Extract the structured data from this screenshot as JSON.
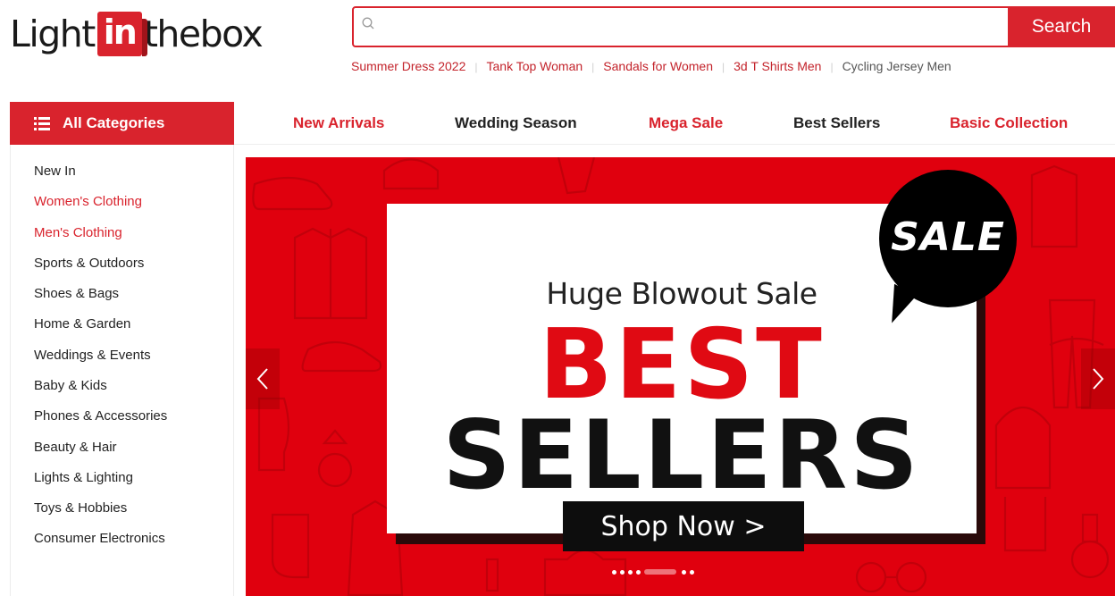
{
  "brand": {
    "logo_left": "Light",
    "logo_box": "in",
    "logo_right": "thebox"
  },
  "search": {
    "value": "",
    "placeholder": "",
    "button_label": "Search"
  },
  "hot_searches": [
    "Summer Dress 2022",
    "Tank Top Woman",
    "Sandals for Women",
    "3d T Shirts Men",
    "Cycling Jersey Men"
  ],
  "all_categories_label": "All Categories",
  "top_nav": [
    "New Arrivals",
    "Wedding Season",
    "Mega Sale",
    "Best Sellers",
    "Basic Collection"
  ],
  "categories": [
    "New In",
    "Women's Clothing",
    "Men's Clothing",
    "Sports & Outdoors",
    "Shoes & Bags",
    "Home & Garden",
    "Weddings & Events",
    "Baby & Kids",
    "Phones & Accessories",
    "Beauty & Hair",
    "Lights & Lighting",
    "Toys & Hobbies",
    "Consumer Electronics"
  ],
  "banner": {
    "subtitle": "Huge Blowout Sale",
    "headline_1": "BEST",
    "headline_2": "SELLERS",
    "badge": "SALE",
    "cta": "Shop Now >",
    "slide_count": 7,
    "active_slide": 5
  },
  "colors": {
    "brand_red": "#d9232d",
    "banner_red": "#e0000e",
    "text_dark": "#222222"
  },
  "icons": {
    "search": "search-icon",
    "menu": "menu-list-icon",
    "prev": "chevron-left-icon",
    "next": "chevron-right-icon"
  }
}
